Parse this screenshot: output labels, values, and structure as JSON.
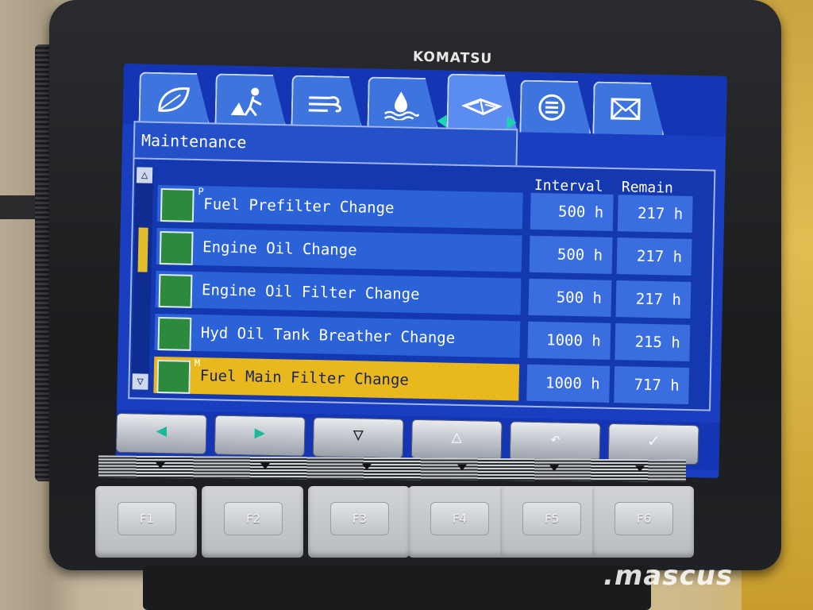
{
  "device": {
    "brand": "KOMATSU",
    "watermark": ".mascus"
  },
  "tabs": [
    {
      "icon": "leaf-icon"
    },
    {
      "icon": "worker-icon"
    },
    {
      "icon": "airflow-icon"
    },
    {
      "icon": "fluid-level-icon"
    },
    {
      "icon": "manual-book-icon",
      "active": true
    },
    {
      "icon": "list-icon"
    },
    {
      "icon": "mail-icon"
    }
  ],
  "screen": {
    "title": "Maintenance",
    "columns": {
      "interval": "Interval",
      "remain": "Remain"
    },
    "rows": [
      {
        "label": "Fuel Prefilter Change",
        "icon": "fuel-prefilter-icon",
        "badge": "P",
        "interval": "500 h",
        "remain": "217 h"
      },
      {
        "label": "Engine Oil Change",
        "icon": "engine-oil-icon",
        "badge": "",
        "interval": "500 h",
        "remain": "217 h"
      },
      {
        "label": "Engine Oil Filter Change",
        "icon": "oil-filter-icon",
        "badge": "",
        "interval": "500 h",
        "remain": "217 h"
      },
      {
        "label": "Hyd Oil Tank Breather Change",
        "icon": "hyd-breather-icon",
        "badge": "",
        "interval": "1000 h",
        "remain": "215 h"
      },
      {
        "label": "Fuel Main Filter Change",
        "icon": "fuel-main-filter-icon",
        "badge": "M",
        "interval": "1000 h",
        "remain": "717 h",
        "selected": true
      }
    ]
  },
  "soft_buttons": [
    {
      "icon": "left-arrow-icon",
      "glyph": "◀"
    },
    {
      "icon": "right-arrow-icon",
      "glyph": "▶"
    },
    {
      "icon": "down-arrow-icon",
      "glyph": "▽"
    },
    {
      "icon": "up-arrow-icon",
      "glyph": "△"
    },
    {
      "icon": "return-icon",
      "glyph": "↶"
    },
    {
      "icon": "check-icon",
      "glyph": "✓"
    }
  ],
  "function_keys": [
    "F1",
    "F2",
    "F3",
    "F4",
    "F5",
    "F6"
  ],
  "colors": {
    "screen_bg": "#1a3ec0",
    "row_bg": "#2c62d8",
    "selected_row": "#e8b81c",
    "accent_arrow": "#18d6b0"
  }
}
